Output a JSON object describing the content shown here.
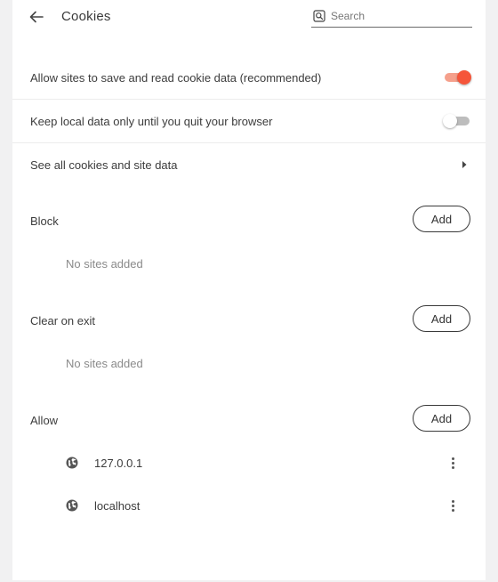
{
  "header": {
    "title": "Cookies",
    "search_placeholder": "Search"
  },
  "settings": [
    {
      "label": "Allow sites to save and read cookie data (recommended)",
      "enabled": true
    },
    {
      "label": "Keep local data only until you quit your browser",
      "enabled": false
    }
  ],
  "see_all": {
    "label": "See all cookies and site data"
  },
  "sections": {
    "block": {
      "title": "Block",
      "add_label": "Add",
      "empty_text": "No sites added"
    },
    "clear_on_exit": {
      "title": "Clear on exit",
      "add_label": "Add",
      "empty_text": "No sites added"
    },
    "allow": {
      "title": "Allow",
      "add_label": "Add",
      "sites": [
        {
          "name": "127.0.0.1",
          "icon": "globe-icon"
        },
        {
          "name": "localhost",
          "icon": "globe-icon"
        }
      ]
    }
  },
  "colors": {
    "accent": "#f5553a",
    "accent_track": "#f5a08c",
    "toggle_off_track": "#bdbdbd",
    "background": "#f1f1f2",
    "card": "#ffffff"
  }
}
